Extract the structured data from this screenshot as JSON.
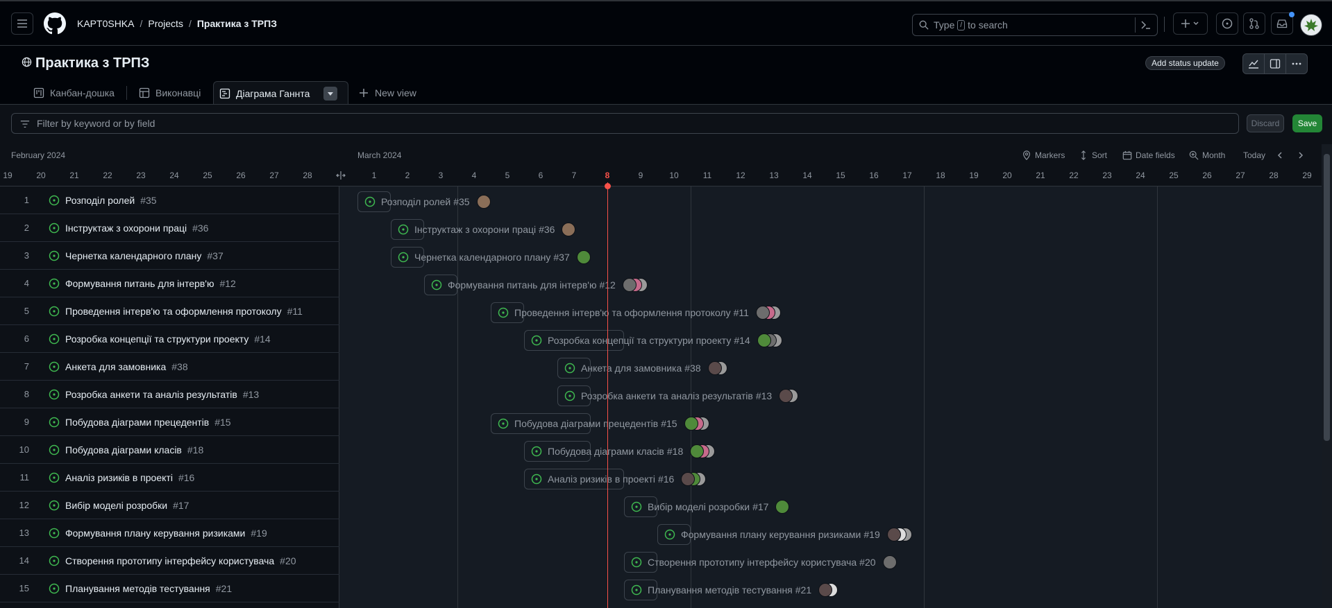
{
  "header": {
    "breadcrumb": [
      "KAPT0SHKA",
      "Projects",
      "Практика з ТРПЗ"
    ],
    "search_placeholder_pre": "Type",
    "search_key": "/",
    "search_placeholder_post": "to search"
  },
  "project": {
    "title": "Практика з ТРПЗ",
    "status_button": "Add status update"
  },
  "tabs": [
    {
      "label": "Канбан-дошка",
      "active": false
    },
    {
      "label": "Виконавці",
      "active": false
    },
    {
      "label": "Діаграма Ганнта",
      "active": true
    },
    {
      "label": "New view",
      "active": false
    }
  ],
  "filter": {
    "placeholder": "Filter by keyword or by field",
    "discard": "Discard",
    "save": "Save"
  },
  "timeline": {
    "months": [
      {
        "label": "February 2024"
      },
      {
        "label": "March 2024"
      }
    ],
    "feb_days": [
      "19",
      "20",
      "21",
      "22",
      "23",
      "24",
      "25",
      "26",
      "27",
      "28"
    ],
    "mar_days": [
      "1",
      "2",
      "3",
      "4",
      "5",
      "6",
      "7",
      "8",
      "9",
      "10",
      "11",
      "12",
      "13",
      "14",
      "15",
      "16",
      "17",
      "18",
      "19",
      "20",
      "21",
      "22",
      "23",
      "24",
      "25",
      "26",
      "27",
      "28",
      "29"
    ],
    "today_day": "8",
    "tools": {
      "markers": "Markers",
      "sort": "Sort",
      "date_fields": "Date fields",
      "zoom": "Month",
      "today": "Today"
    }
  },
  "items": [
    {
      "row": "1",
      "title": "Розподіл ролей",
      "issue": "#35",
      "start": 1,
      "end": 2,
      "avatars": [
        "#8a6e58"
      ]
    },
    {
      "row": "2",
      "title": "Інструктаж з охорони праці",
      "issue": "#36",
      "start": 2,
      "end": 3,
      "avatars": [
        "#8a6e58"
      ]
    },
    {
      "row": "3",
      "title": "Чернетка календарного плану",
      "issue": "#37",
      "start": 2,
      "end": 3,
      "avatars": [
        "#4f8a3a"
      ]
    },
    {
      "row": "4",
      "title": "Формування питань для інтерв'ю",
      "issue": "#12",
      "start": 3,
      "end": 4,
      "avatars": [
        "#6d6d6d",
        "#c76a8b",
        "#9a9a9a"
      ]
    },
    {
      "row": "5",
      "title": "Проведення інтерв'ю та оформлення протоколу",
      "issue": "#11",
      "start": 5,
      "end": 6,
      "avatars": [
        "#6d6d6d",
        "#c76a8b",
        "#9a9a9a"
      ]
    },
    {
      "row": "6",
      "title": "Розробка концепції та структури проекту",
      "issue": "#14",
      "start": 6,
      "end": 9,
      "avatars": [
        "#4f8a3a",
        "#6d6d6d",
        "#9a9a9a"
      ]
    },
    {
      "row": "7",
      "title": "Анкета для замовника",
      "issue": "#38",
      "start": 7,
      "end": 8,
      "avatars": [
        "#5a4a4a",
        "#9a9a9a"
      ]
    },
    {
      "row": "8",
      "title": "Розробка анкети та аналіз результатів",
      "issue": "#13",
      "start": 7,
      "end": 8,
      "avatars": [
        "#5a4a4a",
        "#9a9a9a"
      ]
    },
    {
      "row": "9",
      "title": "Побудова діаграми прецедентів",
      "issue": "#15",
      "start": 5,
      "end": 8,
      "avatars": [
        "#4f8a3a",
        "#c76a8b",
        "#9a9a9a"
      ]
    },
    {
      "row": "10",
      "title": "Побудова діаграми класів",
      "issue": "#18",
      "start": 6,
      "end": 8,
      "avatars": [
        "#4f8a3a",
        "#c76a8b",
        "#9a9a9a"
      ]
    },
    {
      "row": "11",
      "title": "Аналіз ризиків в проекті",
      "issue": "#16",
      "start": 6,
      "end": 9,
      "avatars": [
        "#5a4a4a",
        "#4f8a3a",
        "#9a9a9a"
      ]
    },
    {
      "row": "12",
      "title": "Вибір моделі розробки",
      "issue": "#17",
      "start": 9,
      "end": 10,
      "avatars": [
        "#4f8a3a"
      ]
    },
    {
      "row": "13",
      "title": "Формування плану керування ризиками",
      "issue": "#19",
      "start": 10,
      "end": 11,
      "avatars": [
        "#5a4a4a",
        "#dddddd",
        "#9a9a9a"
      ]
    },
    {
      "row": "14",
      "title": "Створення прототипу інтерфейсу користувача",
      "issue": "#20",
      "start": 9,
      "end": 10,
      "avatars": [
        "#6d6d6d"
      ]
    },
    {
      "row": "15",
      "title": "Планування методів тестування",
      "issue": "#21",
      "start": 9,
      "end": 10,
      "avatars": [
        "#5a4a4a",
        "#dddddd"
      ]
    }
  ],
  "colors": {
    "open_issue": "#3fb950",
    "today": "#f85149",
    "save": "#238636"
  }
}
